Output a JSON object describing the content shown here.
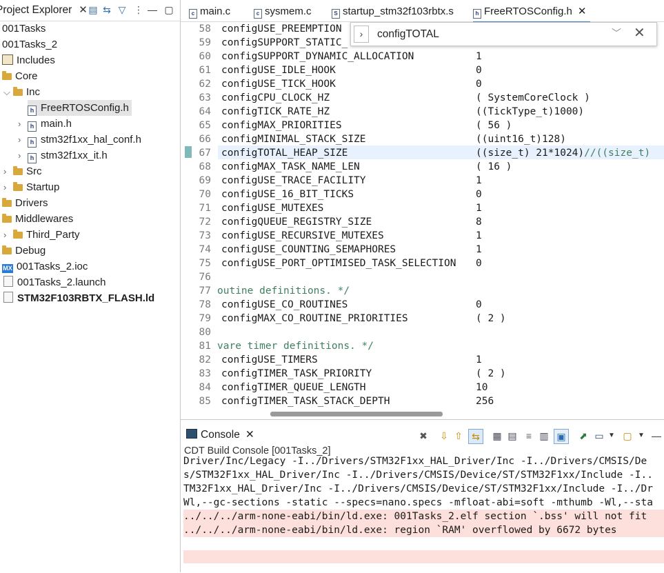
{
  "explorer": {
    "tab_label": "Project Explorer",
    "tree": [
      {
        "label": "001Tasks"
      },
      {
        "label": "001Tasks_2"
      },
      {
        "label": "Includes"
      },
      {
        "label": "Core"
      },
      {
        "label": "Inc"
      },
      {
        "label": "FreeRTOSConfig.h"
      },
      {
        "label": "main.h"
      },
      {
        "label": "stm32f1xx_hal_conf.h"
      },
      {
        "label": "stm32f1xx_it.h"
      },
      {
        "label": "Src"
      },
      {
        "label": "Startup"
      },
      {
        "label": "Drivers"
      },
      {
        "label": "Middlewares"
      },
      {
        "label": "Third_Party"
      },
      {
        "label": "Debug"
      },
      {
        "label": "001Tasks_2.ioc"
      },
      {
        "label": "001Tasks_2.launch"
      },
      {
        "label": "STM32F103RBTX_FLASH.ld"
      }
    ]
  },
  "editor": {
    "tabs": [
      {
        "label": "main.c"
      },
      {
        "label": "sysmem.c"
      },
      {
        "label": "startup_stm32f103rbtx.s"
      },
      {
        "label": "FreeRTOSConfig.h"
      }
    ],
    "find": {
      "value": "configTOTAL"
    },
    "lines": [
      {
        "num": "58",
        "name": "configUSE_PREEMPTION",
        "value": ""
      },
      {
        "num": "59",
        "name": "configSUPPORT_STATIC_",
        "value": ""
      },
      {
        "num": "60",
        "name": "configSUPPORT_DYNAMIC_ALLOCATION",
        "value": "1"
      },
      {
        "num": "61",
        "name": "configUSE_IDLE_HOOK",
        "value": "0"
      },
      {
        "num": "62",
        "name": "configUSE_TICK_HOOK",
        "value": "0"
      },
      {
        "num": "63",
        "name": "configCPU_CLOCK_HZ",
        "value": "( SystemCoreClock )"
      },
      {
        "num": "64",
        "name": "configTICK_RATE_HZ",
        "value": "((TickType_t)1000)"
      },
      {
        "num": "65",
        "name": "configMAX_PRIORITIES",
        "value": "( 56 )"
      },
      {
        "num": "66",
        "name": "configMINIMAL_STACK_SIZE",
        "value": "((uint16_t)128)"
      },
      {
        "num": "67",
        "name": "configTOTAL_HEAP_SIZE",
        "value": "((size_t) 21*1024)",
        "comment": "//((size_t)"
      },
      {
        "num": "68",
        "name": "configMAX_TASK_NAME_LEN",
        "value": "( 16 )"
      },
      {
        "num": "69",
        "name": "configUSE_TRACE_FACILITY",
        "value": "1"
      },
      {
        "num": "70",
        "name": "configUSE_16_BIT_TICKS",
        "value": "0"
      },
      {
        "num": "71",
        "name": "configUSE_MUTEXES",
        "value": "1"
      },
      {
        "num": "72",
        "name": "configQUEUE_REGISTRY_SIZE",
        "value": "8"
      },
      {
        "num": "73",
        "name": "configUSE_RECURSIVE_MUTEXES",
        "value": "1"
      },
      {
        "num": "74",
        "name": "configUSE_COUNTING_SEMAPHORES",
        "value": "1"
      },
      {
        "num": "75",
        "name": "configUSE_PORT_OPTIMISED_TASK_SELECTION",
        "value": "0"
      },
      {
        "num": "76",
        "name": "",
        "value": ""
      },
      {
        "num": "77",
        "name": "",
        "comment_line": "outine definitions. */",
        "value": ""
      },
      {
        "num": "78",
        "name": "configUSE_CO_ROUTINES",
        "value": "0"
      },
      {
        "num": "79",
        "name": "configMAX_CO_ROUTINE_PRIORITIES",
        "value": "( 2 )"
      },
      {
        "num": "80",
        "name": "",
        "value": ""
      },
      {
        "num": "81",
        "name": "",
        "comment_line": "vare timer definitions. */",
        "value": ""
      },
      {
        "num": "82",
        "name": "configUSE_TIMERS",
        "value": "1"
      },
      {
        "num": "83",
        "name": "configTIMER_TASK_PRIORITY",
        "value": "( 2 )"
      },
      {
        "num": "84",
        "name": "configTIMER_QUEUE_LENGTH",
        "value": "10"
      },
      {
        "num": "85",
        "name": "configTIMER_TASK_STACK_DEPTH",
        "value": "256"
      }
    ]
  },
  "console": {
    "tab_label": "Console",
    "title": "CDT Build Console [001Tasks_2]",
    "lines": [
      {
        "text": "Driver/Inc/Legacy -I../Drivers/STM32F1xx_HAL_Driver/Inc -I../Drivers/CMSIS/De",
        "error": false
      },
      {
        "text": "s/STM32F1xx_HAL_Driver/Inc -I../Drivers/CMSIS/Device/ST/STM32F1xx/Include -I..",
        "error": false
      },
      {
        "text": "TM32F1xx_HAL_Driver/Inc -I../Drivers/CMSIS/Device/ST/STM32F1xx/Include -I../Dr",
        "error": false
      },
      {
        "text": "Wl,--gc-sections -static --specs=nano.specs -mfloat-abi=soft -mthumb -Wl,--sta",
        "error": false
      },
      {
        "text": "../../../arm-none-eabi/bin/ld.exe: 001Tasks_2.elf section `.bss' will not fit",
        "error": true
      },
      {
        "text": "../../../arm-none-eabi/bin/ld.exe: region `RAM' overflowed by 6672 bytes",
        "error": true
      }
    ]
  }
}
